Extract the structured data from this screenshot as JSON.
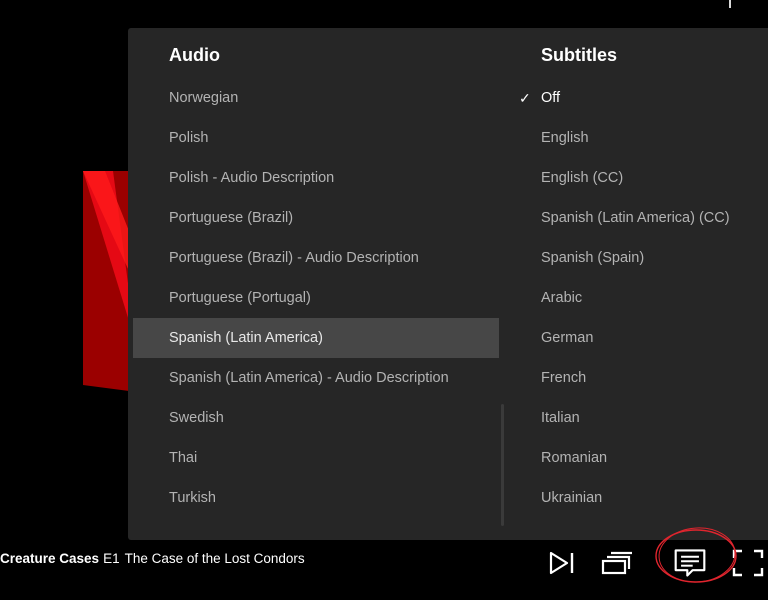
{
  "audio": {
    "header": "Audio",
    "options": [
      "Norwegian",
      "Polish",
      "Polish - Audio Description",
      "Portuguese (Brazil)",
      "Portuguese (Brazil) - Audio Description",
      "Portuguese (Portugal)",
      "Spanish (Latin America)",
      "Spanish (Latin America) - Audio Description",
      "Swedish",
      "Thai",
      "Turkish"
    ],
    "selected": "Spanish (Latin America)"
  },
  "subtitles": {
    "header": "Subtitles",
    "options": [
      "Off",
      "English",
      "English (CC)",
      "Spanish (Latin America) (CC)",
      "Spanish (Spain)",
      "Arabic",
      "German",
      "French",
      "Italian",
      "Romanian",
      "Ukrainian"
    ],
    "selected": "Off",
    "check_icon": "✓"
  },
  "player": {
    "show_title": "Creature Cases",
    "episode": "E1",
    "episode_title": "The Case of the Lost Condors"
  },
  "icons": {
    "next": "next-episode-icon",
    "episodes": "episodes-icon",
    "subtitles": "subtitles-icon",
    "fullscreen": "fullscreen-icon"
  },
  "colors": {
    "panel_bg": "#262626",
    "highlight_bg": "#474747",
    "brand_red": "#e50914",
    "circle_annotation": "#e0252e"
  }
}
